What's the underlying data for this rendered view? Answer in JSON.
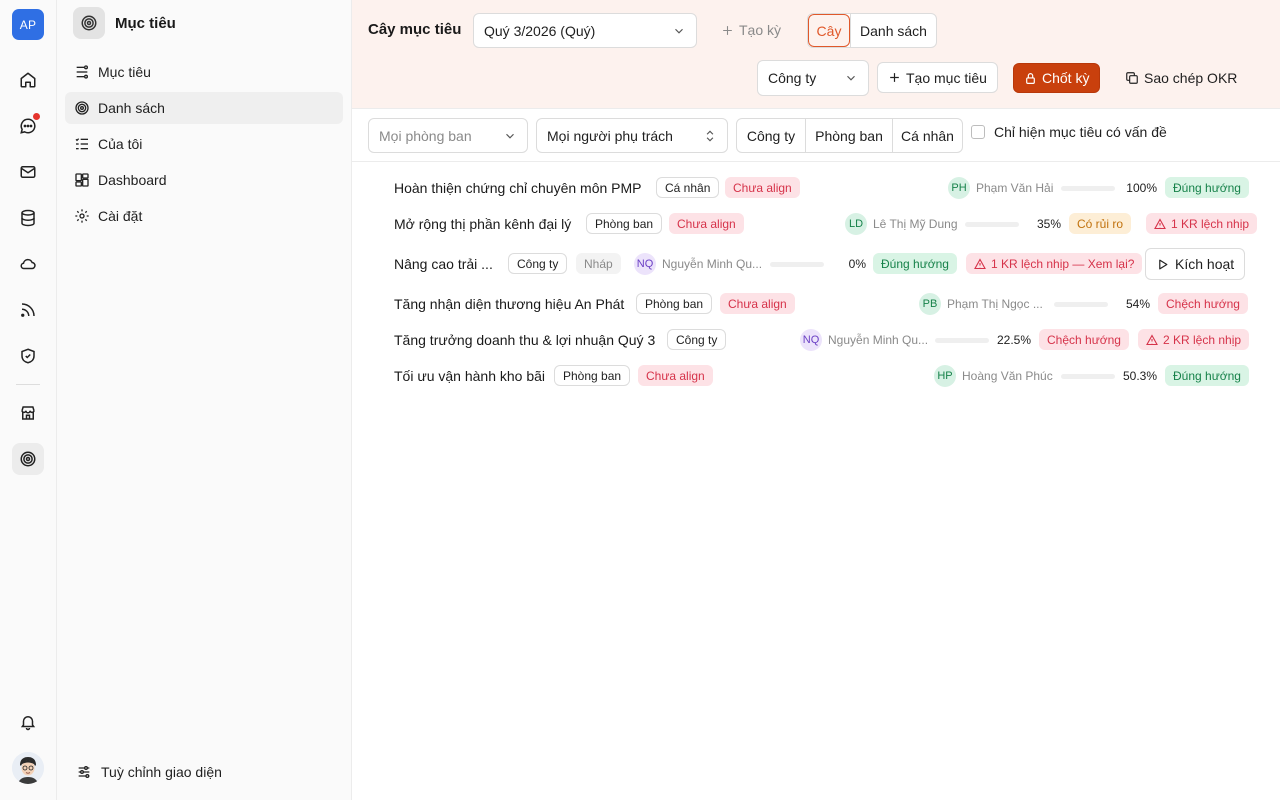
{
  "rail": {
    "logo": "AP",
    "icons": [
      "home-icon",
      "chat-icon",
      "mail-icon",
      "database-icon",
      "cloud-icon",
      "feed-icon",
      "shield-icon",
      "store-icon",
      "target-icon",
      "bell-icon"
    ]
  },
  "sidebar": {
    "title": "Mục tiêu",
    "items": [
      {
        "label": "Mục tiêu"
      },
      {
        "label": "Danh sách"
      },
      {
        "label": "Của tôi"
      },
      {
        "label": "Dashboard"
      },
      {
        "label": "Cài đặt"
      }
    ],
    "footer": "Tuỳ chỉnh giao diện"
  },
  "toolbar": {
    "label": "Cây mục tiêu",
    "period": "Quý 3/2026 (Quý)",
    "create_period": "Tạo kỳ",
    "view_tree": "Cây",
    "view_list": "Danh sách",
    "scope": "Công ty",
    "create_goal": "Tạo mục tiêu",
    "lock_period": "Chốt kỳ",
    "copy_okr": "Sao chép OKR"
  },
  "filters": {
    "department_placeholder": "Mọi phòng ban",
    "owner": "Mọi người phụ trách",
    "levels": [
      "Công ty",
      "Phòng ban",
      "Cá nhân"
    ],
    "issues_only": "Chỉ hiện mục tiêu có vấn đề"
  },
  "goals": [
    {
      "title": "Hoàn thiện chứng chỉ chuyên môn PMP",
      "level": "Cá nhân",
      "align": "Chưa align",
      "initials": "PH",
      "owner": "Phạm Văn Hải",
      "progress": 100,
      "pct": "100%",
      "status": "Đúng hướng"
    },
    {
      "title": "Mở rộng thị phần kênh đại lý",
      "level": "Phòng ban",
      "align": "Chưa align",
      "initials": "LD",
      "owner": "Lê Thị Mỹ Dung",
      "progress": 35,
      "pct": "35%",
      "status": "Có rủi ro",
      "warning": "1 KR lệch nhịp"
    },
    {
      "title": "Nâng cao trải ...",
      "level": "Công ty",
      "draft": "Nháp",
      "initials": "NQ",
      "owner": "Nguyễn Minh Qu...",
      "progress": 0,
      "pct": "0%",
      "status": "Đúng hướng",
      "warning": "1 KR lệch nhịp — Xem lại?",
      "action": "Kích hoạt"
    },
    {
      "title": "Tăng nhận diện thương hiệu An Phát",
      "level": "Phòng ban",
      "align": "Chưa align",
      "initials": "PB",
      "owner": "Phạm Thị Ngọc ...",
      "progress": 54,
      "pct": "54%",
      "status": "Chệch hướng"
    },
    {
      "title": "Tăng trưởng doanh thu & lợi nhuận Quý 3",
      "level": "Công ty",
      "initials": "NQ",
      "owner": "Nguyễn Minh Qu...",
      "progress": 22.5,
      "pct": "22.5%",
      "status": "Chệch hướng",
      "warning": "2 KR lệch nhịp"
    },
    {
      "title": "Tối ưu vận hành kho bãi",
      "level": "Phòng ban",
      "align": "Chưa align",
      "initials": "HP",
      "owner": "Hoàng Văn Phúc",
      "progress": 50.3,
      "pct": "50.3%",
      "status": "Đúng hướng"
    }
  ],
  "colors": {
    "accent": "#e0582a",
    "primary_button": "#c9400d",
    "progress": "#f0661f",
    "on_track": "#17824a",
    "off_track": "#d6334a",
    "at_risk": "#c1720e"
  }
}
